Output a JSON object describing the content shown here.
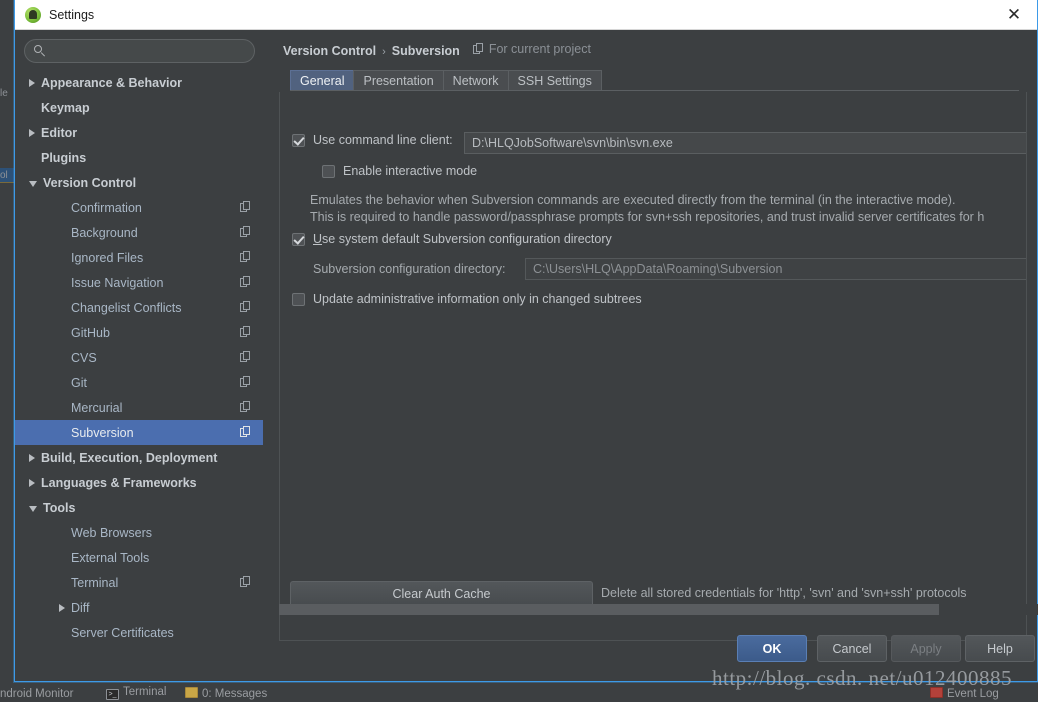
{
  "window": {
    "title": "Settings",
    "app_icon": "android-studio-icon",
    "close_label": "✕",
    "accent_border": "#3d9ae8"
  },
  "search": {
    "placeholder": "",
    "value": "",
    "icon": "search-icon"
  },
  "sidebar": {
    "items": [
      {
        "label": "Appearance & Behavior",
        "level": 0,
        "arrow": "right",
        "top": true,
        "badge": false,
        "selected": false
      },
      {
        "label": "Keymap",
        "level": 0,
        "arrow": "none",
        "top": true,
        "badge": false,
        "selected": false
      },
      {
        "label": "Editor",
        "level": 0,
        "arrow": "right",
        "top": true,
        "badge": false,
        "selected": false
      },
      {
        "label": "Plugins",
        "level": 0,
        "arrow": "none",
        "top": true,
        "badge": false,
        "selected": false
      },
      {
        "label": "Version Control",
        "level": 0,
        "arrow": "down",
        "top": true,
        "badge": false,
        "selected": false
      },
      {
        "label": "Confirmation",
        "level": 1,
        "arrow": "none",
        "top": false,
        "badge": true,
        "selected": false
      },
      {
        "label": "Background",
        "level": 1,
        "arrow": "none",
        "top": false,
        "badge": true,
        "selected": false
      },
      {
        "label": "Ignored Files",
        "level": 1,
        "arrow": "none",
        "top": false,
        "badge": true,
        "selected": false
      },
      {
        "label": "Issue Navigation",
        "level": 1,
        "arrow": "none",
        "top": false,
        "badge": true,
        "selected": false
      },
      {
        "label": "Changelist Conflicts",
        "level": 1,
        "arrow": "none",
        "top": false,
        "badge": true,
        "selected": false
      },
      {
        "label": "GitHub",
        "level": 1,
        "arrow": "none",
        "top": false,
        "badge": true,
        "selected": false
      },
      {
        "label": "CVS",
        "level": 1,
        "arrow": "none",
        "top": false,
        "badge": true,
        "selected": false
      },
      {
        "label": "Git",
        "level": 1,
        "arrow": "none",
        "top": false,
        "badge": true,
        "selected": false
      },
      {
        "label": "Mercurial",
        "level": 1,
        "arrow": "none",
        "top": false,
        "badge": true,
        "selected": false
      },
      {
        "label": "Subversion",
        "level": 1,
        "arrow": "none",
        "top": false,
        "badge": true,
        "selected": true
      },
      {
        "label": "Build, Execution, Deployment",
        "level": 0,
        "arrow": "right",
        "top": true,
        "badge": false,
        "selected": false
      },
      {
        "label": "Languages & Frameworks",
        "level": 0,
        "arrow": "right",
        "top": true,
        "badge": false,
        "selected": false
      },
      {
        "label": "Tools",
        "level": 0,
        "arrow": "down",
        "top": true,
        "badge": false,
        "selected": false
      },
      {
        "label": "Web Browsers",
        "level": 1,
        "arrow": "none",
        "top": false,
        "badge": false,
        "selected": false
      },
      {
        "label": "External Tools",
        "level": 1,
        "arrow": "none",
        "top": false,
        "badge": false,
        "selected": false
      },
      {
        "label": "Terminal",
        "level": 1,
        "arrow": "none",
        "top": false,
        "badge": true,
        "selected": false
      },
      {
        "label": "Diff",
        "level": 1,
        "arrow": "right",
        "top": false,
        "badge": false,
        "selected": false
      },
      {
        "label": "Server Certificates",
        "level": 1,
        "arrow": "none",
        "top": false,
        "badge": false,
        "selected": false
      }
    ]
  },
  "breadcrumb": {
    "parent": "Version Control",
    "separator": "›",
    "current": "Subversion",
    "scope": "For current project",
    "scope_icon": "project-scope-icon"
  },
  "tabs": [
    {
      "label": "General",
      "active": true
    },
    {
      "label": "Presentation",
      "active": false
    },
    {
      "label": "Network",
      "active": false
    },
    {
      "label": "SSH Settings",
      "active": false
    }
  ],
  "main": {
    "use_command_line_client": {
      "label": "Use command line client:",
      "checked": true,
      "path_value": "D:\\HLQJobSoftware\\svn\\bin\\svn.exe"
    },
    "enable_interactive_mode": {
      "label": "Enable interactive mode",
      "checked": false
    },
    "interactive_desc_line1": "Emulates the behavior when Subversion commands are executed directly from the terminal (in the interactive mode).",
    "interactive_desc_line2": "This is required to handle password/passphrase prompts for svn+ssh repositories, and trust invalid server certificates for h",
    "use_system_default_config": {
      "label": "Use system default Subversion configuration directory",
      "checked": true
    },
    "config_directory": {
      "label": "Subversion configuration directory:",
      "value": "C:\\Users\\HLQ\\AppData\\Roaming\\Subversion"
    },
    "update_admin_info": {
      "label": "Update administrative information only in changed subtrees",
      "checked": false
    },
    "clear_auth_cache": {
      "button_label": "Clear Auth Cache",
      "description": "Delete all stored credentials for 'http', 'svn' and 'svn+ssh' protocols"
    }
  },
  "dialog_buttons": [
    {
      "label": "OK",
      "style": "primary"
    },
    {
      "label": "Cancel",
      "style": "normal"
    },
    {
      "label": "Apply",
      "style": "disabled"
    },
    {
      "label": "Help",
      "style": "normal"
    }
  ],
  "ide_background": {
    "status_items": [
      {
        "label": "ndroid Monitor",
        "icon": ""
      },
      {
        "label": "Terminal",
        "icon": "terminal-icon"
      },
      {
        "label": "0: Messages",
        "icon": "messages-icon"
      },
      {
        "label": "Event Log",
        "icon": "event-log-icon"
      }
    ],
    "left_strip_labels": [
      "le",
      "ol"
    ]
  },
  "watermark": {
    "text": "http://blog. csdn. net/u012400885"
  }
}
